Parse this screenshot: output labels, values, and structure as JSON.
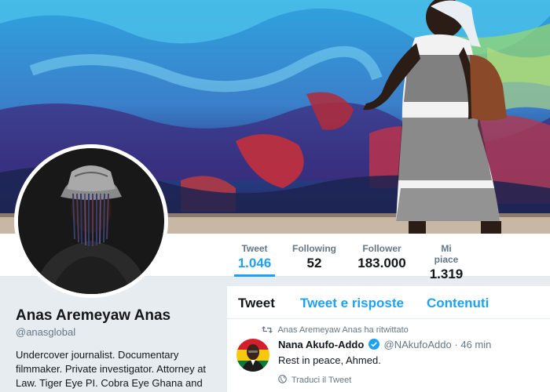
{
  "profile": {
    "name": "Anas Aremeyaw Anas",
    "handle": "@anasglobal",
    "bio": "Undercover journalist. Documentary filmmaker. Private investigator. Attorney at Law. Tiger Eye PI. Cobra Eye Ghana and"
  },
  "stats": {
    "tweet": {
      "label": "Tweet",
      "value": "1.046"
    },
    "following": {
      "label": "Following",
      "value": "52"
    },
    "follower": {
      "label": "Follower",
      "value": "183.000"
    },
    "likes": {
      "label": "Mi piace",
      "value": "1.319"
    }
  },
  "tabs": [
    {
      "label": "Tweet",
      "active": true
    },
    {
      "label": "Tweet e risposte",
      "active": false
    },
    {
      "label": "Contenuti",
      "active": false
    }
  ],
  "tweet": {
    "retweet_note": "Anas Aremeyaw Anas ha ritwittato",
    "author_name": "Nana Akufo-Addo",
    "author_handle": "@NAkufoAddo",
    "separator": "·",
    "time": "46 min",
    "text": "Rest in peace, Ahmed.",
    "translate_label": "Traduci il Tweet"
  },
  "colors": {
    "accent": "#1da1f2",
    "background": "#e6ecf0",
    "muted_text": "#657786"
  },
  "icons": {
    "retweet": "retweet-icon",
    "verified": "verified-badge-icon",
    "translate": "globe-icon"
  }
}
